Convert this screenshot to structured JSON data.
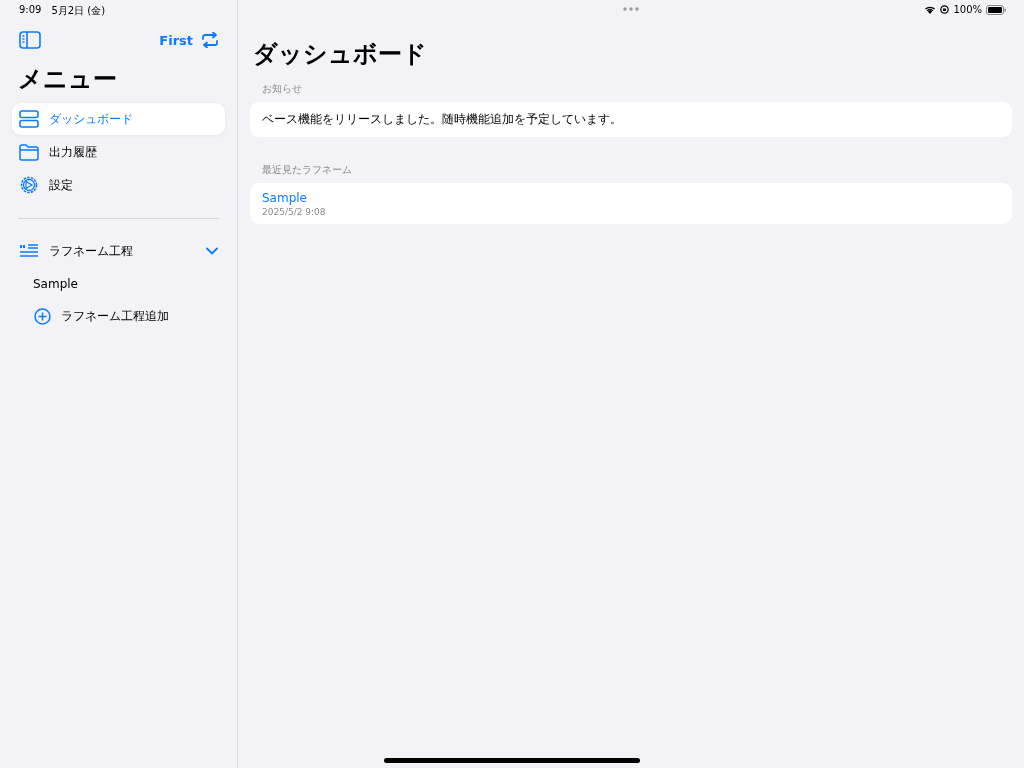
{
  "status_bar": {
    "time": "9:09",
    "date": "5月2日 (金)",
    "battery": "100%"
  },
  "sidebar": {
    "toolbar_title": "First",
    "title": "メニュー",
    "items": [
      {
        "kind": "dashboard",
        "label": "ダッシュボード",
        "selected": true
      },
      {
        "kind": "folder",
        "label": "出力履歴",
        "selected": false
      },
      {
        "kind": "settings",
        "label": "設定",
        "selected": false
      }
    ],
    "section": {
      "label": "ラフネーム工程",
      "expanded": true,
      "children": [
        {
          "kind": "item",
          "label": "Sample"
        },
        {
          "kind": "add",
          "label": "ラフネーム工程追加"
        }
      ]
    }
  },
  "main": {
    "title": "ダッシュボード",
    "notice": {
      "heading": "お知らせ",
      "text": "ベース機能をリリースしました。随時機能追加を予定しています。"
    },
    "recent": {
      "heading": "最近見たラフネーム",
      "items": [
        {
          "title": "Sample",
          "date": "2025/5/2 9:08"
        }
      ]
    }
  }
}
